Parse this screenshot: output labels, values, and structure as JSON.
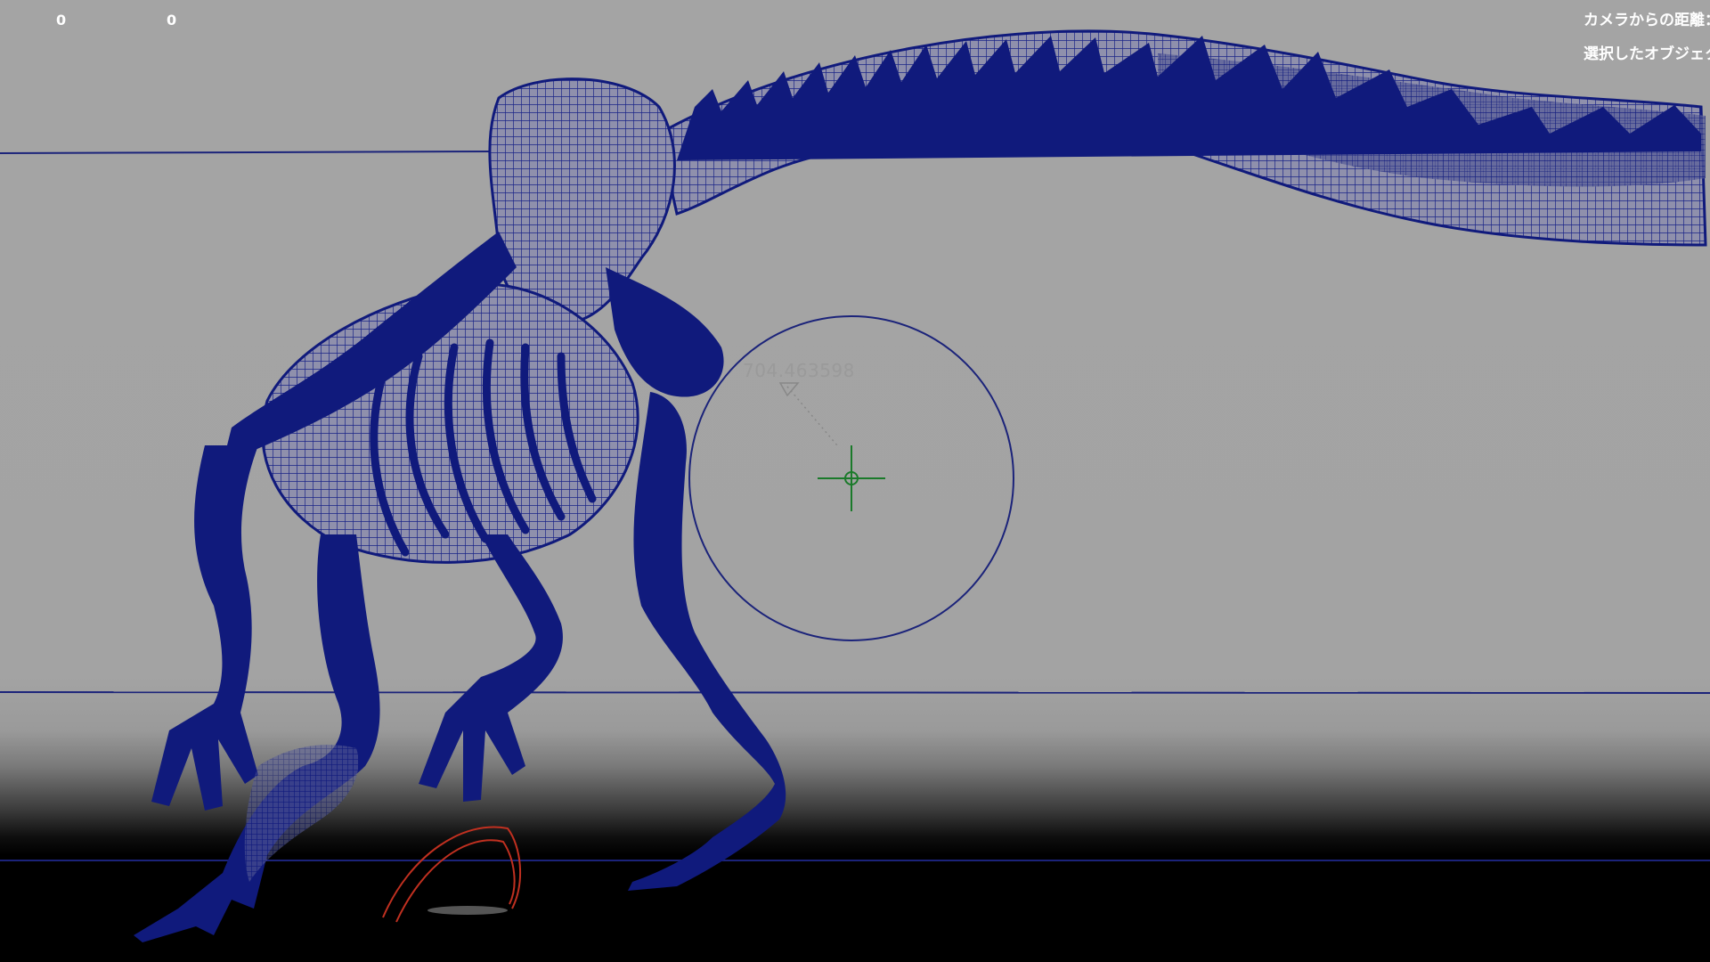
{
  "hud": {
    "counter_a": "0",
    "counter_b": "0",
    "info_line_1": "カメラからの距離：",
    "info_line_2": "選択したオブジェク"
  },
  "viewport": {
    "distance_readout": "704.463598",
    "model_color": "#101a7c",
    "background_color": "#a4a4a4",
    "grid_line_color": "#1b237a",
    "locator_color": "#1a7a2a",
    "curve_color": "#c03020"
  }
}
